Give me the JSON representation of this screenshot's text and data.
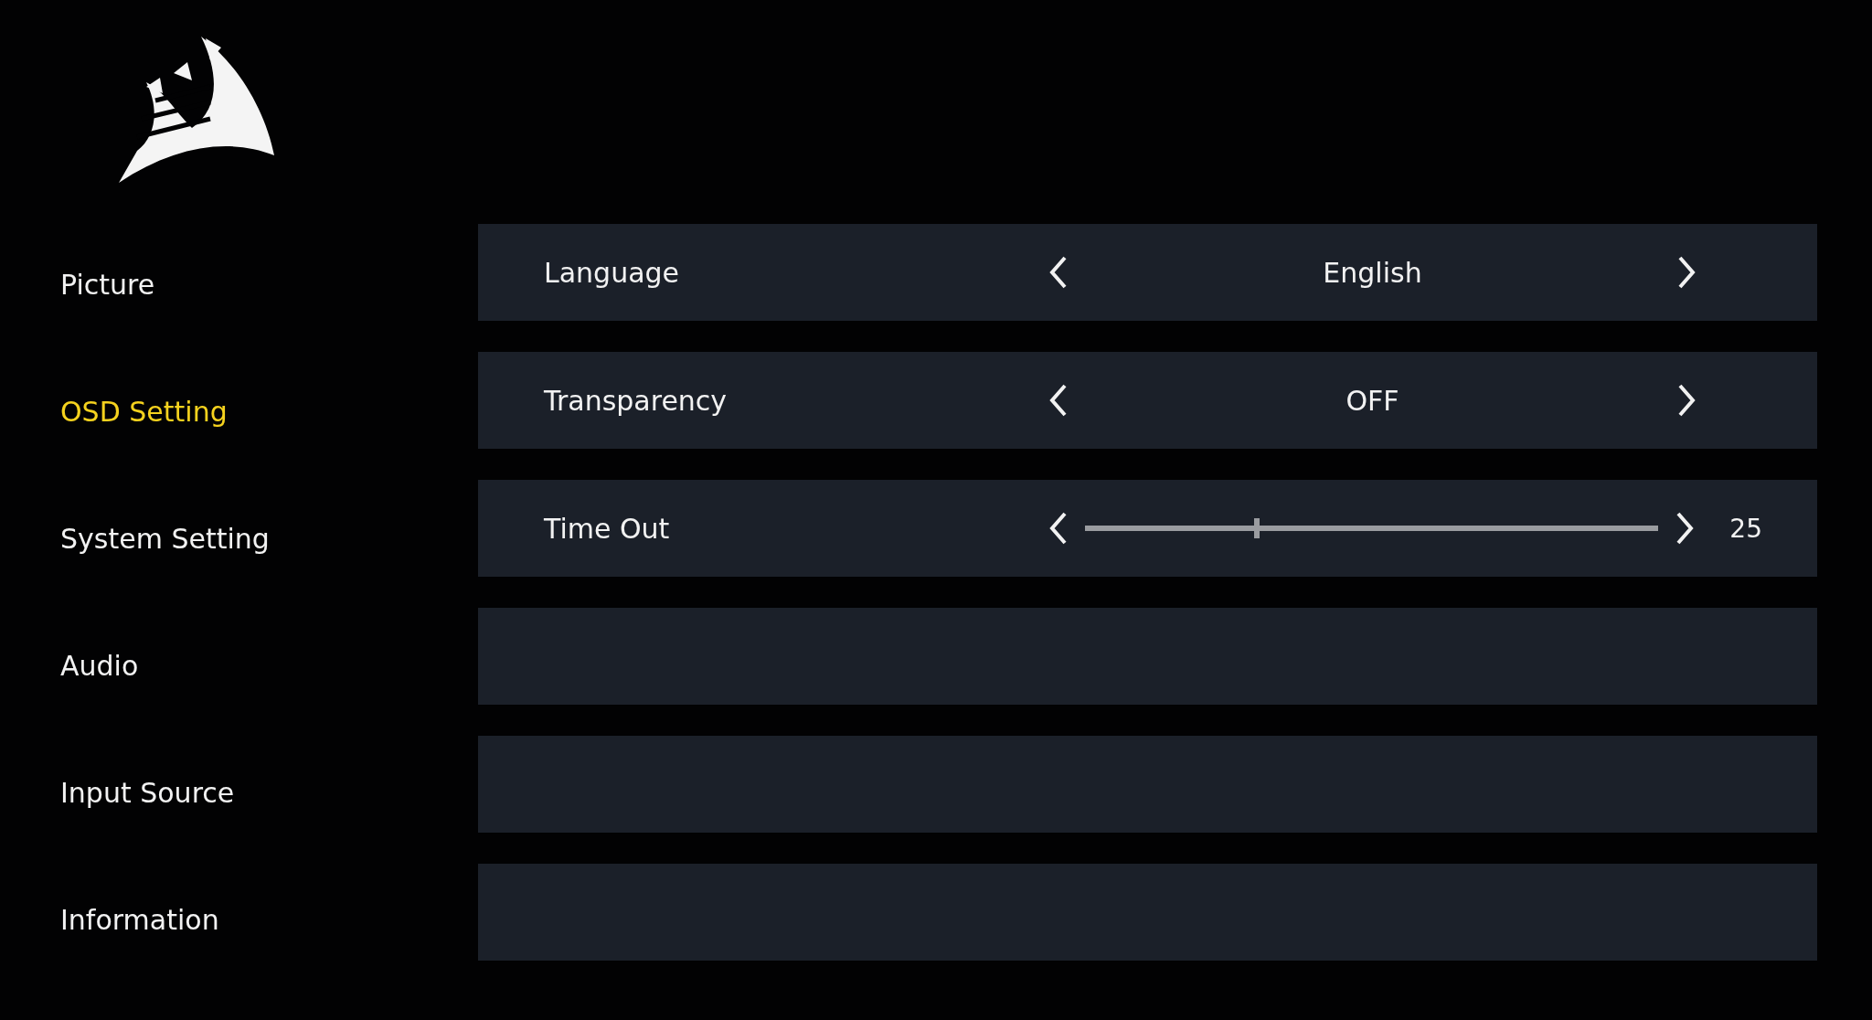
{
  "menu": [
    {
      "label": "Picture",
      "selected": false
    },
    {
      "label": "OSD Setting",
      "selected": true
    },
    {
      "label": "System Setting",
      "selected": false
    },
    {
      "label": "Audio",
      "selected": false
    },
    {
      "label": "Input Source",
      "selected": false
    },
    {
      "label": "Information",
      "selected": false
    }
  ],
  "settings": [
    {
      "kind": "select",
      "label": "Language",
      "value": "English"
    },
    {
      "kind": "select",
      "label": "Transparency",
      "value": "OFF"
    },
    {
      "kind": "slider",
      "label": "Time Out",
      "level": 0.3,
      "reading": "25"
    },
    {
      "kind": "empty"
    },
    {
      "kind": "empty"
    },
    {
      "kind": "empty"
    }
  ]
}
